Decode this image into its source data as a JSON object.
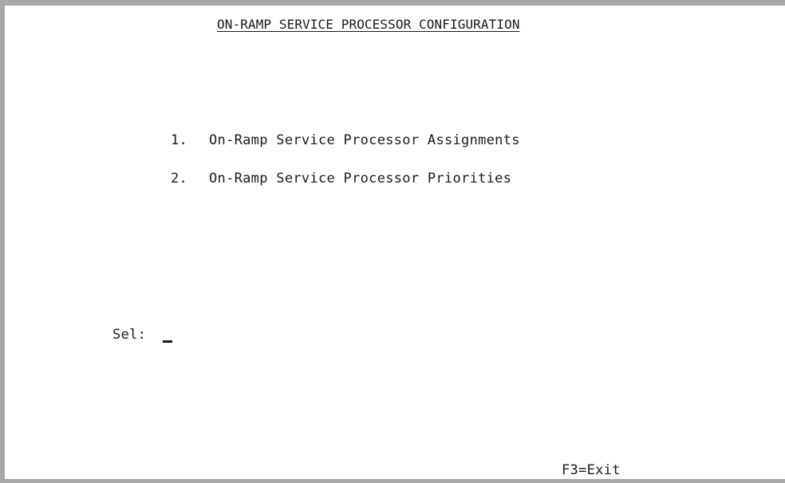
{
  "screen": {
    "title": "ON-RAMP SERVICE PROCESSOR CONFIGURATION"
  },
  "menu": {
    "items": [
      {
        "number": "1.",
        "label": "On-Ramp Service Processor Assignments"
      },
      {
        "number": "2.",
        "label": "On-Ramp Service Processor Priorities"
      }
    ]
  },
  "selection": {
    "label": "Sel:",
    "value": ""
  },
  "function_keys": {
    "f3": "F3=Exit"
  },
  "colors": {
    "frame": "#a8a8a8",
    "background": "#ffffff",
    "text": "#1a1a1a"
  }
}
